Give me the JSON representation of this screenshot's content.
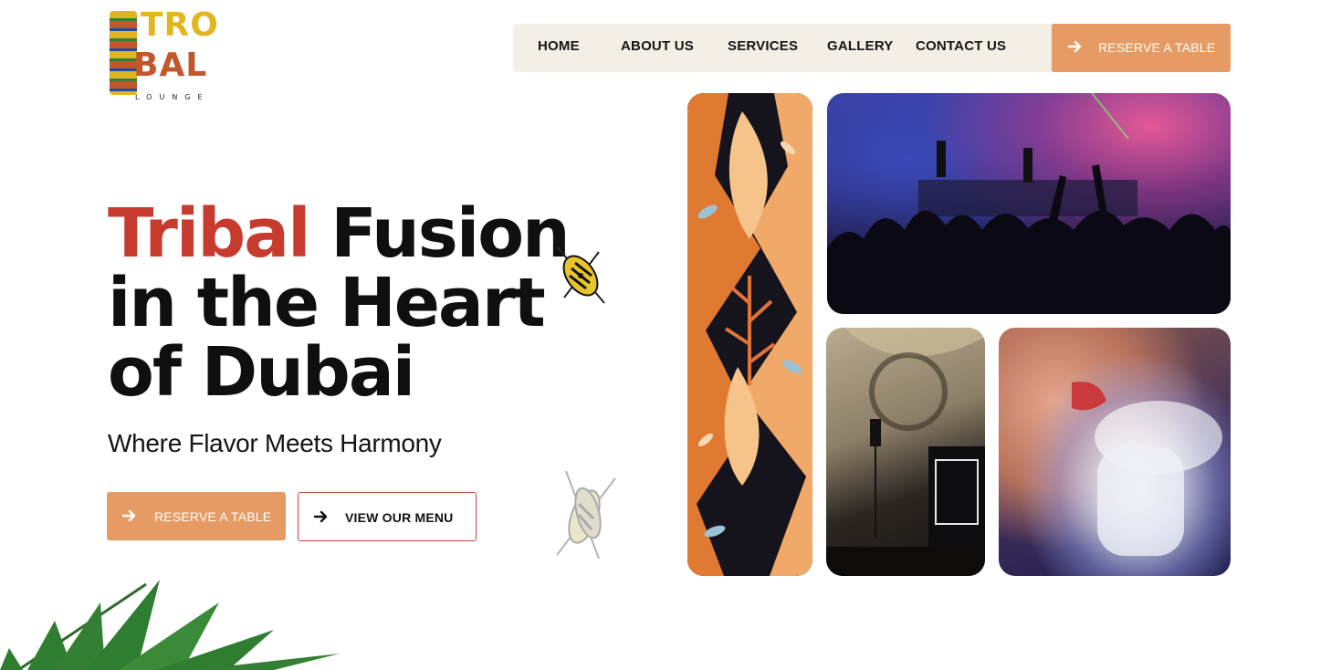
{
  "logo": {
    "line1": "TRO",
    "line2": "BAL",
    "subtitle": "LOUNGE"
  },
  "nav": {
    "items": [
      {
        "label": "HOME"
      },
      {
        "label": "ABOUT US"
      },
      {
        "label": "SERVICES"
      },
      {
        "label": "GALLERY"
      },
      {
        "label": "CONTACT US"
      }
    ],
    "cta_label": "RESERVE A TABLE"
  },
  "hero": {
    "title_accent": "Tribal",
    "title_rest_1": " Fusion",
    "title_line2": "in the Heart",
    "title_line3": "of Dubai",
    "subtitle": "Where Flavor Meets Harmony",
    "primary_button": "RESERVE A TABLE",
    "secondary_button": "VIEW OUR MENU"
  },
  "icons": {
    "arrow": "arrow-right-icon",
    "shield": "tribal-shield-icon",
    "leaf": "palm-leaf"
  },
  "colors": {
    "accent_orange": "#e59b63",
    "accent_red": "#c73b2e",
    "nav_bg": "#f3efe6",
    "text_dark": "#0f0f0f"
  }
}
